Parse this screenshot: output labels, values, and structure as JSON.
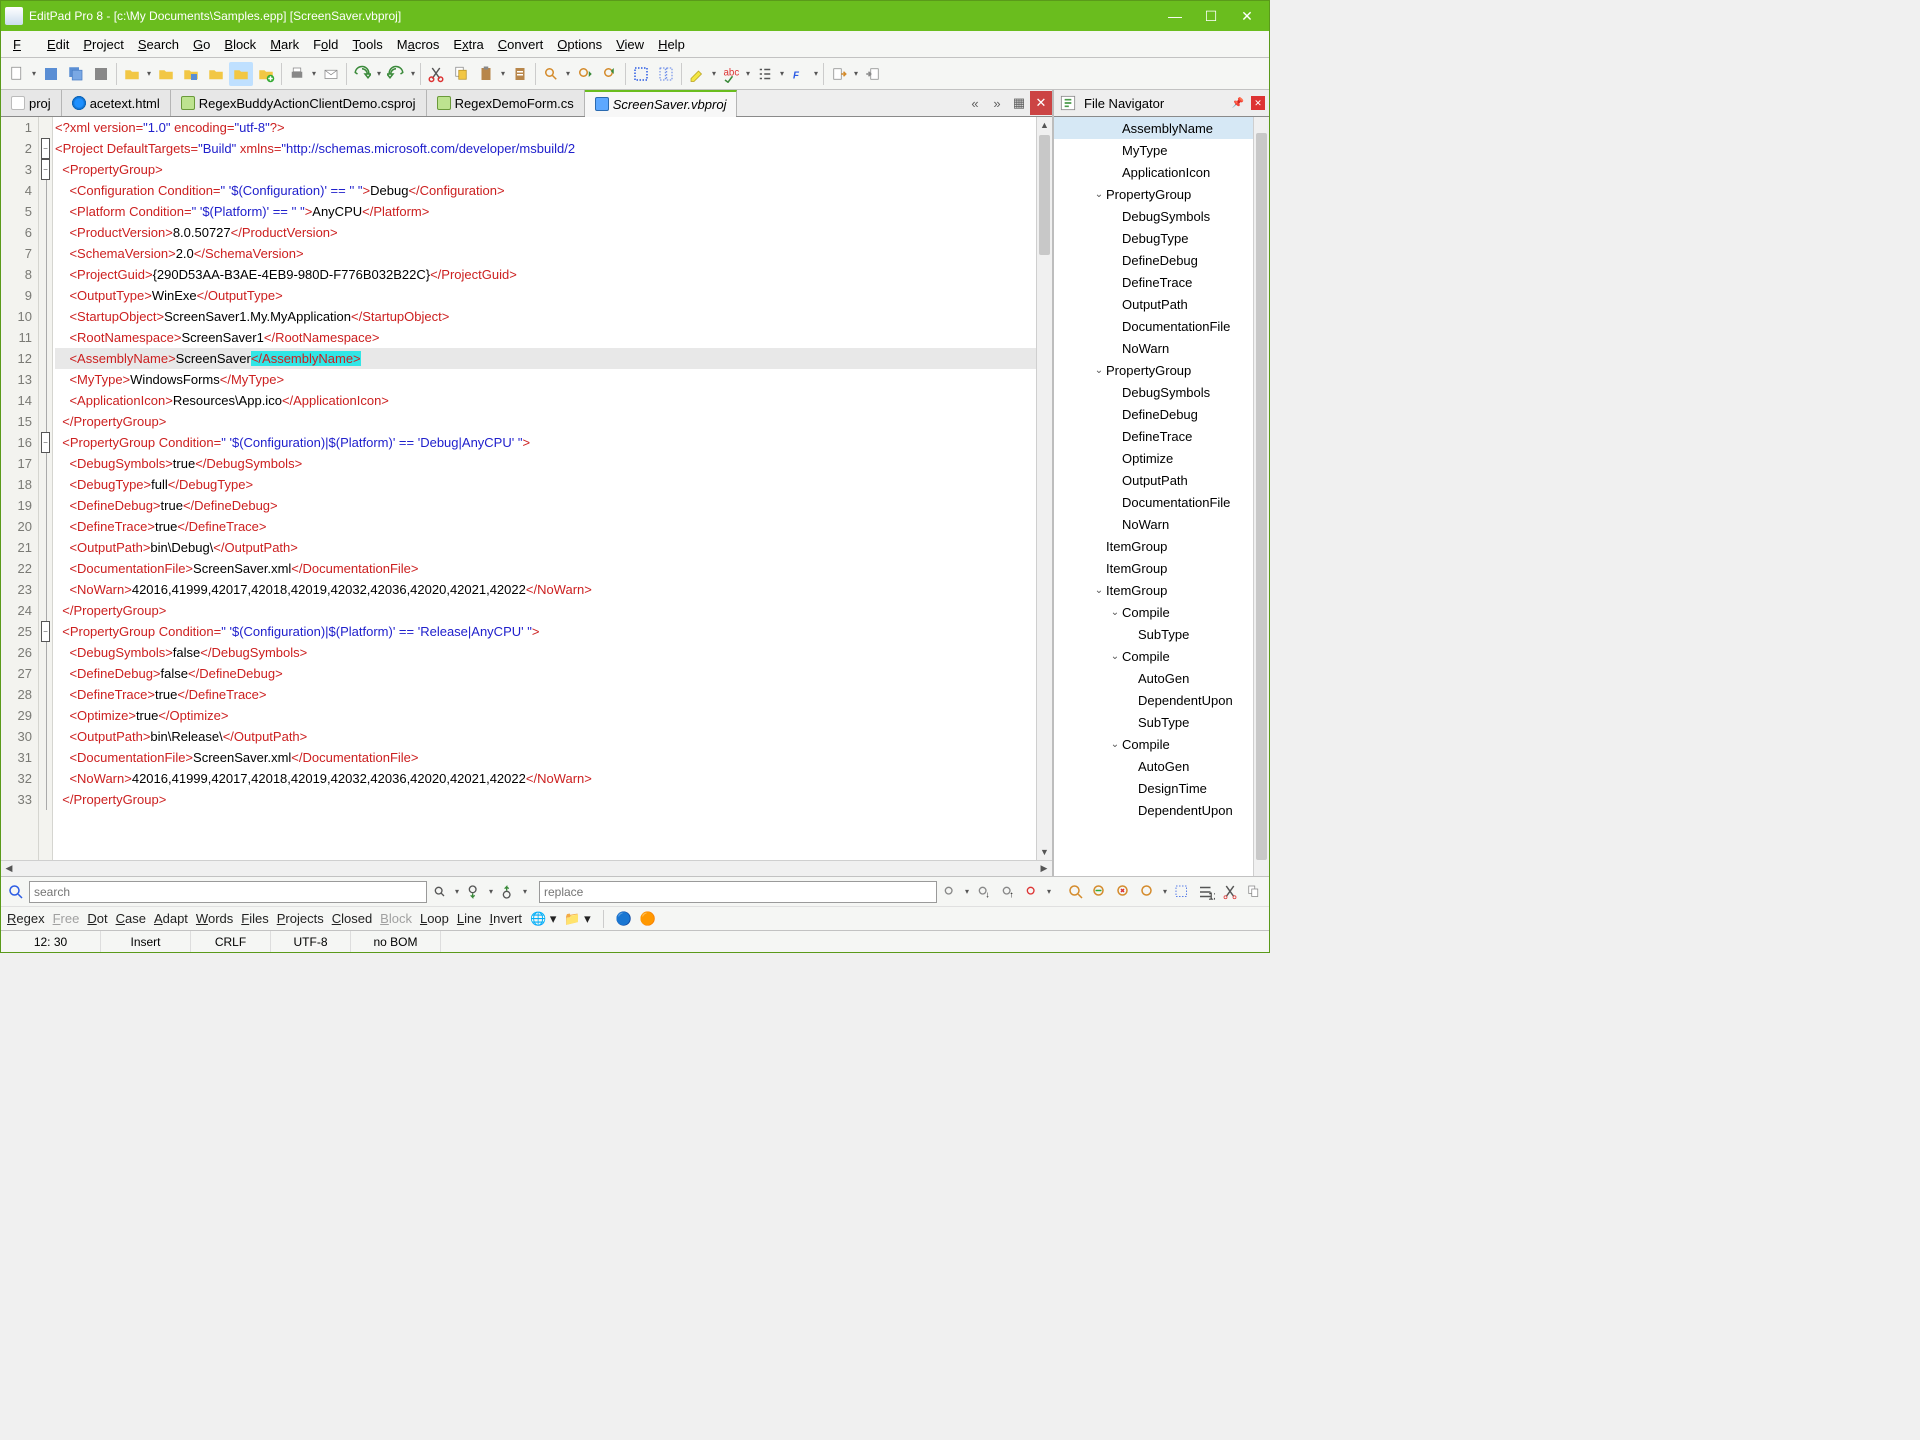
{
  "window": {
    "title": "EditPad Pro 8 - [c:\\My Documents\\Samples.epp] [ScreenSaver.vbproj]"
  },
  "menu": {
    "file": "File",
    "edit": "Edit",
    "project": "Project",
    "search": "Search",
    "go": "Go",
    "block": "Block",
    "mark": "Mark",
    "fold": "Fold",
    "tools": "Tools",
    "macros": "Macros",
    "extra": "Extra",
    "convert": "Convert",
    "options": "Options",
    "view": "View",
    "help": "Help"
  },
  "tabs": [
    {
      "label": "proj",
      "icon": "txt"
    },
    {
      "label": "acetext.html",
      "icon": "edge"
    },
    {
      "label": "RegexBuddyActionClientDemo.csproj",
      "icon": "cs"
    },
    {
      "label": "RegexDemoForm.cs",
      "icon": "cs"
    },
    {
      "label": "ScreenSaver.vbproj",
      "icon": "vb",
      "active": true
    }
  ],
  "gutter_start": 1,
  "gutter_end": 33,
  "highlighted_line": 12,
  "code_lines": [
    [
      [
        "t-tag",
        "<?"
      ],
      [
        "t-attr",
        "xml"
      ],
      [
        "t-txt",
        " "
      ],
      [
        "t-attr",
        "version="
      ],
      [
        "t-val",
        "\"1.0\""
      ],
      [
        "t-txt",
        " "
      ],
      [
        "t-attr",
        "encoding="
      ],
      [
        "t-val",
        "\"utf-8\""
      ],
      [
        "t-tag",
        "?>"
      ]
    ],
    [
      [
        "t-tag",
        "<"
      ],
      [
        "t-tag",
        "Project"
      ],
      [
        "t-txt",
        " "
      ],
      [
        "t-attr",
        "DefaultTargets="
      ],
      [
        "t-val",
        "\"Build\""
      ],
      [
        "t-txt",
        " "
      ],
      [
        "t-attr",
        "xmlns="
      ],
      [
        "t-val",
        "\"http://schemas.microsoft.com/developer/msbuild/2"
      ]
    ],
    [
      [
        "t-txt",
        "  "
      ],
      [
        "t-tag",
        "<PropertyGroup>"
      ]
    ],
    [
      [
        "t-txt",
        "    "
      ],
      [
        "t-tag",
        "<Configuration"
      ],
      [
        "t-txt",
        " "
      ],
      [
        "t-attr",
        "Condition="
      ],
      [
        "t-val",
        "\" '$(Configuration)' == '' \""
      ],
      [
        "t-tag",
        ">"
      ],
      [
        "t-txt",
        "Debug"
      ],
      [
        "t-tag",
        "</Configuration>"
      ]
    ],
    [
      [
        "t-txt",
        "    "
      ],
      [
        "t-tag",
        "<Platform"
      ],
      [
        "t-txt",
        " "
      ],
      [
        "t-attr",
        "Condition="
      ],
      [
        "t-val",
        "\" '$(Platform)' == '' \""
      ],
      [
        "t-tag",
        ">"
      ],
      [
        "t-txt",
        "AnyCPU"
      ],
      [
        "t-tag",
        "</Platform>"
      ]
    ],
    [
      [
        "t-txt",
        "    "
      ],
      [
        "t-tag",
        "<ProductVersion>"
      ],
      [
        "t-txt",
        "8.0.50727"
      ],
      [
        "t-tag",
        "</ProductVersion>"
      ]
    ],
    [
      [
        "t-txt",
        "    "
      ],
      [
        "t-tag",
        "<SchemaVersion>"
      ],
      [
        "t-txt",
        "2.0"
      ],
      [
        "t-tag",
        "</SchemaVersion>"
      ]
    ],
    [
      [
        "t-txt",
        "    "
      ],
      [
        "t-tag",
        "<ProjectGuid>"
      ],
      [
        "t-txt",
        "{290D53AA-B3AE-4EB9-980D-F776B032B22C}"
      ],
      [
        "t-tag",
        "</ProjectGuid>"
      ]
    ],
    [
      [
        "t-txt",
        "    "
      ],
      [
        "t-tag",
        "<OutputType>"
      ],
      [
        "t-txt",
        "WinExe"
      ],
      [
        "t-tag",
        "</OutputType>"
      ]
    ],
    [
      [
        "t-txt",
        "    "
      ],
      [
        "t-tag",
        "<StartupObject>"
      ],
      [
        "t-txt",
        "ScreenSaver1.My.MyApplication"
      ],
      [
        "t-tag",
        "</StartupObject>"
      ]
    ],
    [
      [
        "t-txt",
        "    "
      ],
      [
        "t-tag",
        "<RootNamespace>"
      ],
      [
        "t-txt",
        "ScreenSaver1"
      ],
      [
        "t-tag",
        "</RootNamespace>"
      ]
    ],
    [
      [
        "t-txt",
        "    "
      ],
      [
        "t-tag",
        "<AssemblyName>"
      ],
      [
        "t-txt",
        "ScreenSaver"
      ],
      [
        "t-tag cur-sel",
        "</AssemblyName>"
      ]
    ],
    [
      [
        "t-txt",
        "    "
      ],
      [
        "t-tag",
        "<MyType>"
      ],
      [
        "t-txt",
        "WindowsForms"
      ],
      [
        "t-tag",
        "</MyType>"
      ]
    ],
    [
      [
        "t-txt",
        "    "
      ],
      [
        "t-tag",
        "<ApplicationIcon>"
      ],
      [
        "t-txt",
        "Resources\\App.ico"
      ],
      [
        "t-tag",
        "</ApplicationIcon>"
      ]
    ],
    [
      [
        "t-txt",
        "  "
      ],
      [
        "t-tag",
        "</PropertyGroup>"
      ]
    ],
    [
      [
        "t-txt",
        "  "
      ],
      [
        "t-tag",
        "<PropertyGroup"
      ],
      [
        "t-txt",
        " "
      ],
      [
        "t-attr",
        "Condition="
      ],
      [
        "t-val",
        "\" '$(Configuration)|$(Platform)' == 'Debug|AnyCPU' \""
      ],
      [
        "t-tag",
        ">"
      ]
    ],
    [
      [
        "t-txt",
        "    "
      ],
      [
        "t-tag",
        "<DebugSymbols>"
      ],
      [
        "t-txt",
        "true"
      ],
      [
        "t-tag",
        "</DebugSymbols>"
      ]
    ],
    [
      [
        "t-txt",
        "    "
      ],
      [
        "t-tag",
        "<DebugType>"
      ],
      [
        "t-txt",
        "full"
      ],
      [
        "t-tag",
        "</DebugType>"
      ]
    ],
    [
      [
        "t-txt",
        "    "
      ],
      [
        "t-tag",
        "<DefineDebug>"
      ],
      [
        "t-txt",
        "true"
      ],
      [
        "t-tag",
        "</DefineDebug>"
      ]
    ],
    [
      [
        "t-txt",
        "    "
      ],
      [
        "t-tag",
        "<DefineTrace>"
      ],
      [
        "t-txt",
        "true"
      ],
      [
        "t-tag",
        "</DefineTrace>"
      ]
    ],
    [
      [
        "t-txt",
        "    "
      ],
      [
        "t-tag",
        "<OutputPath>"
      ],
      [
        "t-txt",
        "bin\\Debug\\"
      ],
      [
        "t-tag",
        "</OutputPath>"
      ]
    ],
    [
      [
        "t-txt",
        "    "
      ],
      [
        "t-tag",
        "<DocumentationFile>"
      ],
      [
        "t-txt",
        "ScreenSaver.xml"
      ],
      [
        "t-tag",
        "</DocumentationFile>"
      ]
    ],
    [
      [
        "t-txt",
        "    "
      ],
      [
        "t-tag",
        "<NoWarn>"
      ],
      [
        "t-txt",
        "42016,41999,42017,42018,42019,42032,42036,42020,42021,42022"
      ],
      [
        "t-tag",
        "</NoWarn>"
      ]
    ],
    [
      [
        "t-txt",
        "  "
      ],
      [
        "t-tag",
        "</PropertyGroup>"
      ]
    ],
    [
      [
        "t-txt",
        "  "
      ],
      [
        "t-tag",
        "<PropertyGroup"
      ],
      [
        "t-txt",
        " "
      ],
      [
        "t-attr",
        "Condition="
      ],
      [
        "t-val",
        "\" '$(Configuration)|$(Platform)' == 'Release|AnyCPU' \""
      ],
      [
        "t-tag",
        ">"
      ]
    ],
    [
      [
        "t-txt",
        "    "
      ],
      [
        "t-tag",
        "<DebugSymbols>"
      ],
      [
        "t-txt",
        "false"
      ],
      [
        "t-tag",
        "</DebugSymbols>"
      ]
    ],
    [
      [
        "t-txt",
        "    "
      ],
      [
        "t-tag",
        "<DefineDebug>"
      ],
      [
        "t-txt",
        "false"
      ],
      [
        "t-tag",
        "</DefineDebug>"
      ]
    ],
    [
      [
        "t-txt",
        "    "
      ],
      [
        "t-tag",
        "<DefineTrace>"
      ],
      [
        "t-txt",
        "true"
      ],
      [
        "t-tag",
        "</DefineTrace>"
      ]
    ],
    [
      [
        "t-txt",
        "    "
      ],
      [
        "t-tag",
        "<Optimize>"
      ],
      [
        "t-txt",
        "true"
      ],
      [
        "t-tag",
        "</Optimize>"
      ]
    ],
    [
      [
        "t-txt",
        "    "
      ],
      [
        "t-tag",
        "<OutputPath>"
      ],
      [
        "t-txt",
        "bin\\Release\\"
      ],
      [
        "t-tag",
        "</OutputPath>"
      ]
    ],
    [
      [
        "t-txt",
        "    "
      ],
      [
        "t-tag",
        "<DocumentationFile>"
      ],
      [
        "t-txt",
        "ScreenSaver.xml"
      ],
      [
        "t-tag",
        "</DocumentationFile>"
      ]
    ],
    [
      [
        "t-txt",
        "    "
      ],
      [
        "t-tag",
        "<NoWarn>"
      ],
      [
        "t-txt",
        "42016,41999,42017,42018,42019,42032,42036,42020,42021,42022"
      ],
      [
        "t-tag",
        "</NoWarn>"
      ]
    ],
    [
      [
        "t-txt",
        "  "
      ],
      [
        "t-tag",
        "</PropertyGroup>"
      ]
    ]
  ],
  "fold_markers": {
    "2": "box",
    "3": "box",
    "16": "box",
    "25": "box"
  },
  "navigator": {
    "title": "File Navigator",
    "items": [
      {
        "indent": 3,
        "label": "AssemblyName",
        "selected": true
      },
      {
        "indent": 3,
        "label": "MyType"
      },
      {
        "indent": 3,
        "label": "ApplicationIcon"
      },
      {
        "indent": 2,
        "label": "PropertyGroup",
        "exp": "down"
      },
      {
        "indent": 3,
        "label": "DebugSymbols"
      },
      {
        "indent": 3,
        "label": "DebugType"
      },
      {
        "indent": 3,
        "label": "DefineDebug"
      },
      {
        "indent": 3,
        "label": "DefineTrace"
      },
      {
        "indent": 3,
        "label": "OutputPath"
      },
      {
        "indent": 3,
        "label": "DocumentationFile"
      },
      {
        "indent": 3,
        "label": "NoWarn"
      },
      {
        "indent": 2,
        "label": "PropertyGroup",
        "exp": "down"
      },
      {
        "indent": 3,
        "label": "DebugSymbols"
      },
      {
        "indent": 3,
        "label": "DefineDebug"
      },
      {
        "indent": 3,
        "label": "DefineTrace"
      },
      {
        "indent": 3,
        "label": "Optimize"
      },
      {
        "indent": 3,
        "label": "OutputPath"
      },
      {
        "indent": 3,
        "label": "DocumentationFile"
      },
      {
        "indent": 3,
        "label": "NoWarn"
      },
      {
        "indent": 2,
        "label": "ItemGroup"
      },
      {
        "indent": 2,
        "label": "ItemGroup"
      },
      {
        "indent": 2,
        "label": "ItemGroup",
        "exp": "down"
      },
      {
        "indent": 3,
        "label": "Compile",
        "exp": "down"
      },
      {
        "indent": 4,
        "label": "SubType"
      },
      {
        "indent": 3,
        "label": "Compile",
        "exp": "down"
      },
      {
        "indent": 4,
        "label": "AutoGen"
      },
      {
        "indent": 4,
        "label": "DependentUpon"
      },
      {
        "indent": 4,
        "label": "SubType"
      },
      {
        "indent": 3,
        "label": "Compile",
        "exp": "down"
      },
      {
        "indent": 4,
        "label": "AutoGen"
      },
      {
        "indent": 4,
        "label": "DesignTime"
      },
      {
        "indent": 4,
        "label": "DependentUpon"
      }
    ]
  },
  "search": {
    "placeholder_find": "search",
    "placeholder_replace": "replace"
  },
  "options": [
    "Regex",
    "Free",
    "Dot",
    "Case",
    "Adapt",
    "Words",
    "Files",
    "Projects",
    "Closed",
    "Block",
    "Loop",
    "Line",
    "Invert"
  ],
  "options_disabled": [
    "Free",
    "Block"
  ],
  "status": {
    "pos": "12: 30",
    "insert": "Insert",
    "eol": "CRLF",
    "enc": "UTF-8",
    "bom": "no BOM"
  }
}
